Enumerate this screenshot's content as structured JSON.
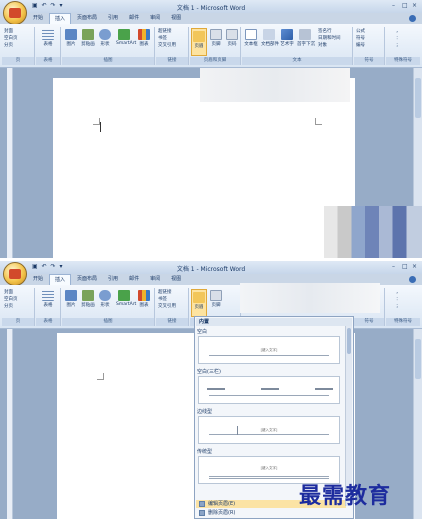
{
  "window": {
    "title": "文档 1 - Microsoft Word",
    "quick_access": "▣ ↶ ↷ ▾",
    "minimize": "–",
    "restore": "□",
    "close": "×"
  },
  "tabs": [
    "开始",
    "插入",
    "页面布局",
    "引用",
    "邮件",
    "审阅",
    "视图"
  ],
  "active_tab": "插入",
  "ribbon": {
    "groups": {
      "pages": {
        "label": "页",
        "items": [
          "封面",
          "空白页",
          "分页"
        ]
      },
      "tables": {
        "label": "表格",
        "button": "表格"
      },
      "illustrations": {
        "label": "插图",
        "buttons": [
          "图片",
          "剪贴画",
          "形状",
          "SmartArt",
          "图表"
        ]
      },
      "links": {
        "label": "链接",
        "items": [
          "超链接",
          "书签",
          "交叉引用"
        ]
      },
      "header_footer": {
        "label": "页眉和页脚",
        "buttons": [
          "页眉",
          "页脚",
          "页码"
        ]
      },
      "text": {
        "label": "文本",
        "buttons": [
          "文本框",
          "文档部件",
          "艺术字",
          "首字下沉"
        ],
        "items": [
          "签名行",
          "日期和时间",
          "对象"
        ]
      },
      "symbols": {
        "label": "符号",
        "items": [
          "公式",
          "符号",
          "编号"
        ]
      },
      "special": {
        "label": "特殊符号",
        "items": [
          "，",
          "：",
          "；"
        ]
      }
    }
  },
  "dropdown": {
    "section_header": "内置",
    "presets": [
      "空白",
      "空白(三栏)",
      "边线型",
      "传统型"
    ],
    "preview_text": "[键入文字]",
    "commands": [
      "编辑页眉(E)",
      "删除页眉(R)"
    ]
  },
  "watermark": "最需教育",
  "colors": {
    "ribbon_bg": "#dfe9f5",
    "active_highlight": "#fde3a0",
    "workspace": "#97acc7",
    "watermark": "#1d2c9e"
  }
}
